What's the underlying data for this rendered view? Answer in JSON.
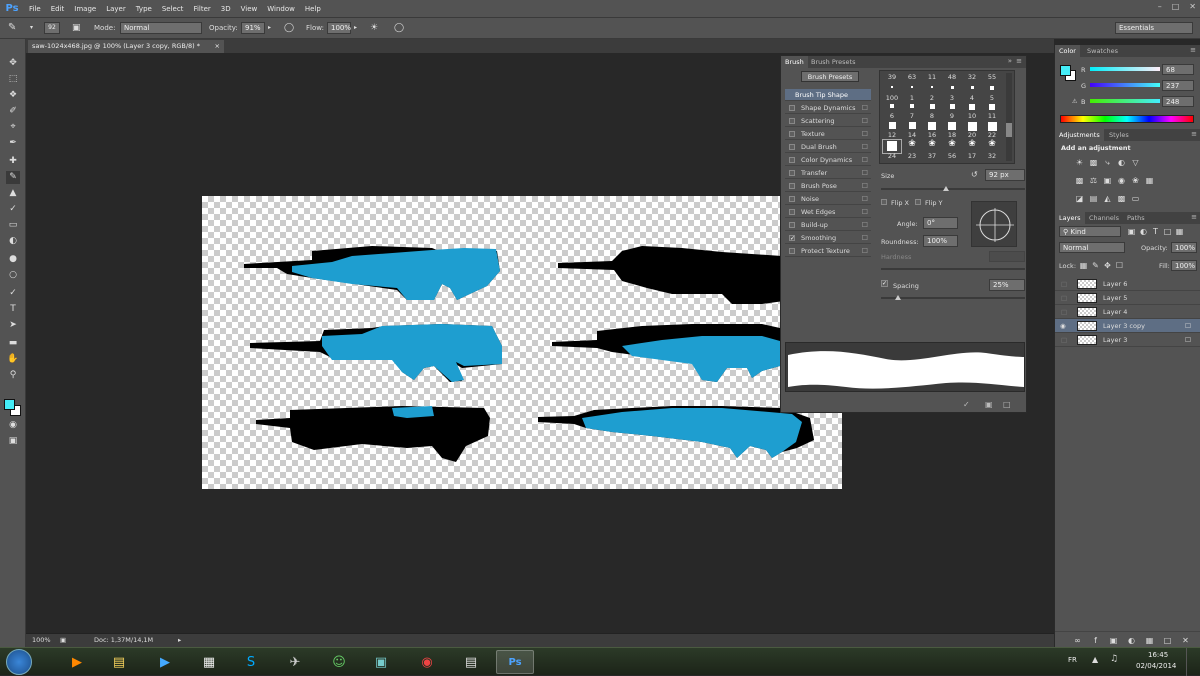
{
  "app": {
    "logo": "Ps",
    "accent": "#4da3ff"
  },
  "menu": [
    "File",
    "Edit",
    "Image",
    "Layer",
    "Type",
    "Select",
    "Filter",
    "3D",
    "View",
    "Window",
    "Help"
  ],
  "options": {
    "brush_size": "92",
    "mode_label": "Mode:",
    "mode_value": "Normal",
    "opacity_label": "Opacity:",
    "opacity_value": "91%",
    "flow_label": "Flow:",
    "flow_value": "100%",
    "workspace": "Essentials"
  },
  "document": {
    "tab_title": "saw-1024x468.jpg @ 100% (Layer 3 copy, RGB/8) *",
    "zoom": "100%",
    "doc_size": "Doc: 1,37M/14,1M"
  },
  "brush_panel": {
    "tabs": [
      "Brush",
      "Brush Presets"
    ],
    "presets_button": "Brush Presets",
    "options": [
      {
        "label": "Brush Tip Shape",
        "checked": false,
        "selected": true
      },
      {
        "label": "Shape Dynamics",
        "checked": false
      },
      {
        "label": "Scattering",
        "checked": false
      },
      {
        "label": "Texture",
        "checked": false
      },
      {
        "label": "Dual Brush",
        "checked": false
      },
      {
        "label": "Color Dynamics",
        "checked": false
      },
      {
        "label": "Transfer",
        "checked": false
      },
      {
        "label": "Brush Pose",
        "checked": false
      },
      {
        "label": "Noise",
        "checked": false
      },
      {
        "label": "Wet Edges",
        "checked": false
      },
      {
        "label": "Build-up",
        "checked": false
      },
      {
        "label": "Smoothing",
        "checked": true
      },
      {
        "label": "Protect Texture",
        "checked": false
      }
    ],
    "tips": [
      [
        "39",
        "63",
        "11",
        "48",
        "32",
        "55"
      ],
      [
        "",
        "",
        "",
        "",
        "",
        ""
      ],
      [
        "100",
        "1",
        "2",
        "3",
        "4",
        "5"
      ],
      [
        "6",
        "7",
        "8",
        "9",
        "10",
        "11"
      ],
      [
        "12",
        "14",
        "16",
        "18",
        "20",
        "22"
      ],
      [
        "24",
        "23",
        "37",
        "56",
        "17",
        "32"
      ]
    ],
    "size_label": "Size",
    "size_value": "92 px",
    "flip_x": "Flip X",
    "flip_y": "Flip Y",
    "angle_label": "Angle:",
    "angle_value": "0°",
    "roundness_label": "Roundness:",
    "roundness_value": "100%",
    "hardness_label": "Hardness",
    "spacing_label": "Spacing",
    "spacing_value": "25%"
  },
  "color_panel": {
    "tabs": [
      "Color",
      "Swatches"
    ],
    "r": "68",
    "g": "237",
    "b": "248",
    "fg_color": "#44edf8"
  },
  "adjustments": {
    "tabs": [
      "Adjustments",
      "Styles"
    ],
    "heading": "Add an adjustment"
  },
  "layers": {
    "tabs": [
      "Layers",
      "Channels",
      "Paths"
    ],
    "kind": "Kind",
    "blend": "Normal",
    "opacity_label": "Opacity:",
    "opacity_value": "100%",
    "lock_label": "Lock:",
    "fill_label": "Fill:",
    "fill_value": "100%",
    "items": [
      {
        "name": "Layer 6",
        "selected": false
      },
      {
        "name": "Layer 5",
        "selected": false
      },
      {
        "name": "Layer 4",
        "selected": false
      },
      {
        "name": "Layer 3 copy",
        "selected": true
      },
      {
        "name": "Layer 3",
        "selected": false
      }
    ]
  },
  "taskbar": {
    "lang": "FR",
    "time": "16:45",
    "date": "02/04/2014"
  }
}
